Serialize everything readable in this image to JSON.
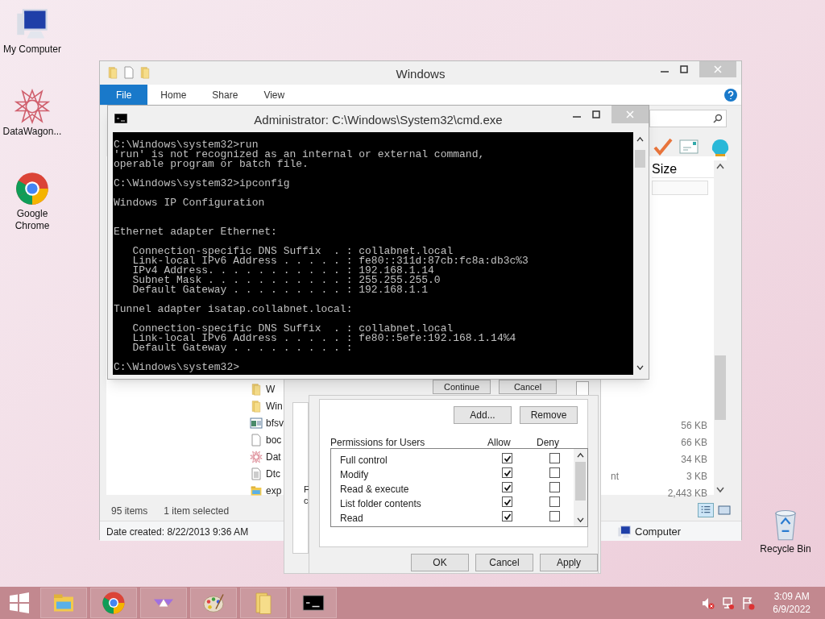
{
  "desktop_icons": [
    {
      "kind": "computer",
      "label": "My Computer"
    },
    {
      "kind": "datawagon",
      "label": "DataWagon..."
    },
    {
      "kind": "chrome",
      "label": "Google Chrome"
    },
    {
      "kind": "recycle",
      "label": "Recycle Bin"
    }
  ],
  "explorer": {
    "title": "Windows",
    "ribbon_tabs": [
      {
        "label": "File",
        "selected": true
      },
      {
        "label": "Home",
        "selected": false
      },
      {
        "label": "Share",
        "selected": false
      },
      {
        "label": "View",
        "selected": false
      }
    ],
    "column_header": "Size",
    "files": [
      {
        "kind": "folder",
        "name": "W"
      },
      {
        "kind": "folder",
        "name": "Win"
      },
      {
        "kind": "app",
        "name": "bfsv"
      },
      {
        "kind": "blank",
        "name": "boc"
      },
      {
        "kind": "datawagon",
        "name": "Dat"
      },
      {
        "kind": "text",
        "name": "Dtc"
      },
      {
        "kind": "explorer",
        "name": "exp"
      }
    ],
    "sizes": [
      "56 KB",
      "66 KB",
      "34 KB",
      "3 KB",
      "2,443 KB"
    ],
    "type_fragment": "nt",
    "item_count": "95 items",
    "selection": "1 item selected",
    "date_created": "Date created: 8/22/2013 9:36 AM",
    "location": "Computer"
  },
  "back_dialog": {
    "buttons": [
      "Continue",
      "Cancel"
    ],
    "text_fragments": [
      "F",
      "c"
    ]
  },
  "permissions_dialog": {
    "top_buttons": [
      "Add...",
      "Remove"
    ],
    "heading": "Permissions for Users",
    "columns": [
      "Allow",
      "Deny"
    ],
    "permissions": [
      {
        "name": "Full control",
        "allow": true,
        "deny": false
      },
      {
        "name": "Modify",
        "allow": true,
        "deny": false
      },
      {
        "name": "Read & execute",
        "allow": true,
        "deny": false
      },
      {
        "name": "List folder contents",
        "allow": true,
        "deny": false
      },
      {
        "name": "Read",
        "allow": true,
        "deny": false
      }
    ],
    "buttons": [
      "OK",
      "Cancel",
      "Apply"
    ]
  },
  "cmd": {
    "title": "Administrator: C:\\Windows\\System32\\cmd.exe",
    "output": "C:\\Windows\\system32>run\n'run' is not recognized as an internal or external command,\noperable program or batch file.\n\nC:\\Windows\\system32>ipconfig\n\nWindows IP Configuration\n\n\nEthernet adapter Ethernet:\n\n   Connection-specific DNS Suffix  . : collabnet.local\n   Link-local IPv6 Address . . . . . : fe80::311d:87cb:fc8a:db3c%3\n   IPv4 Address. . . . . . . . . . . : 192.168.1.14\n   Subnet Mask . . . . . . . . . . . : 255.255.255.0\n   Default Gateway . . . . . . . . . : 192.168.1.1\n\nTunnel adapter isatap.collabnet.local:\n\n   Connection-specific DNS Suffix  . : collabnet.local\n   Link-local IPv6 Address . . . . . : fe80::5efe:192.168.1.14%4\n   Default Gateway . . . . . . . . . :\n\nC:\\Windows\\system32>"
  },
  "taskbar": {
    "apps": [
      {
        "kind": "explorer"
      },
      {
        "kind": "chrome"
      },
      {
        "kind": "arrows"
      },
      {
        "kind": "paint"
      },
      {
        "kind": "folder"
      },
      {
        "kind": "cmd"
      }
    ],
    "time": "3:09 AM",
    "date": "6/9/2022"
  }
}
